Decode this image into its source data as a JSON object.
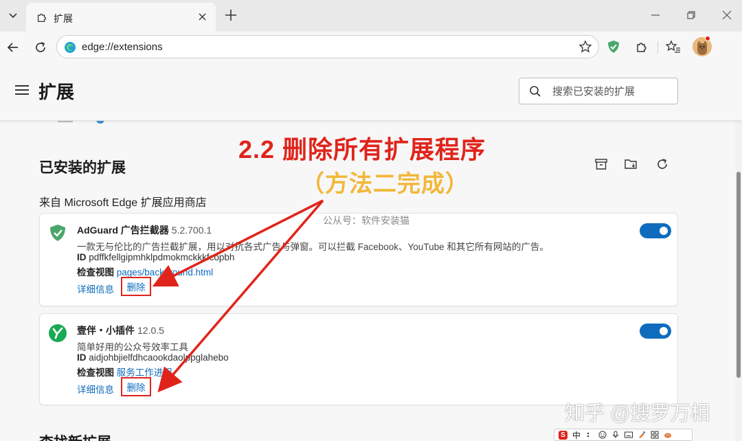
{
  "browser": {
    "tab_title": "扩展",
    "url": "edge://extensions"
  },
  "header": {
    "title": "扩展",
    "search_placeholder": "搜索已安装的扩展"
  },
  "installed": {
    "title": "已安装的扩展",
    "source": "来自 Microsoft Edge 扩展应用商店"
  },
  "extensions": [
    {
      "name": "AdGuard 广告拦截器",
      "version": "5.2.700.1",
      "description": "一款无与伦比的广告拦截扩展，用以对抗各式广告与弹窗。可以拦截 Facebook、YouTube 和其它所有网站的广告。",
      "id_label": "ID",
      "id": "pdffkfellgipmhklpdmokmckkkfcopbh",
      "inspect_label": "检查视图",
      "inspect_link": "pages/background.html",
      "details": "详细信息",
      "remove": "删除",
      "enabled": true,
      "icon": "adguard-shield-icon",
      "icon_color": "#4aa66b"
    },
    {
      "name": "壹伴・小插件",
      "version": "12.0.5",
      "description": "简单好用的公众号效率工具",
      "id_label": "ID",
      "id": "aidjohbjielfdhcaookdaolppglahebo",
      "inspect_label": "检查视图",
      "inspect_link": "服务工作进程",
      "details": "详细信息",
      "remove": "删除",
      "enabled": true,
      "icon": "yiban-logo-icon",
      "icon_color": "#1aaa55"
    }
  ],
  "next_section": "查找新扩展",
  "annotation": {
    "title": "2.2 删除所有扩展程序",
    "subtitle": "（方法二完成）",
    "watermark": "公从号：软件安装猫",
    "signature": "知乎 @搜罗万相"
  },
  "ime": {
    "mode": "中"
  },
  "colors": {
    "accent": "#0f6cbd",
    "annotation_red": "#e0241b",
    "annotation_yellow": "#f3b73a"
  }
}
